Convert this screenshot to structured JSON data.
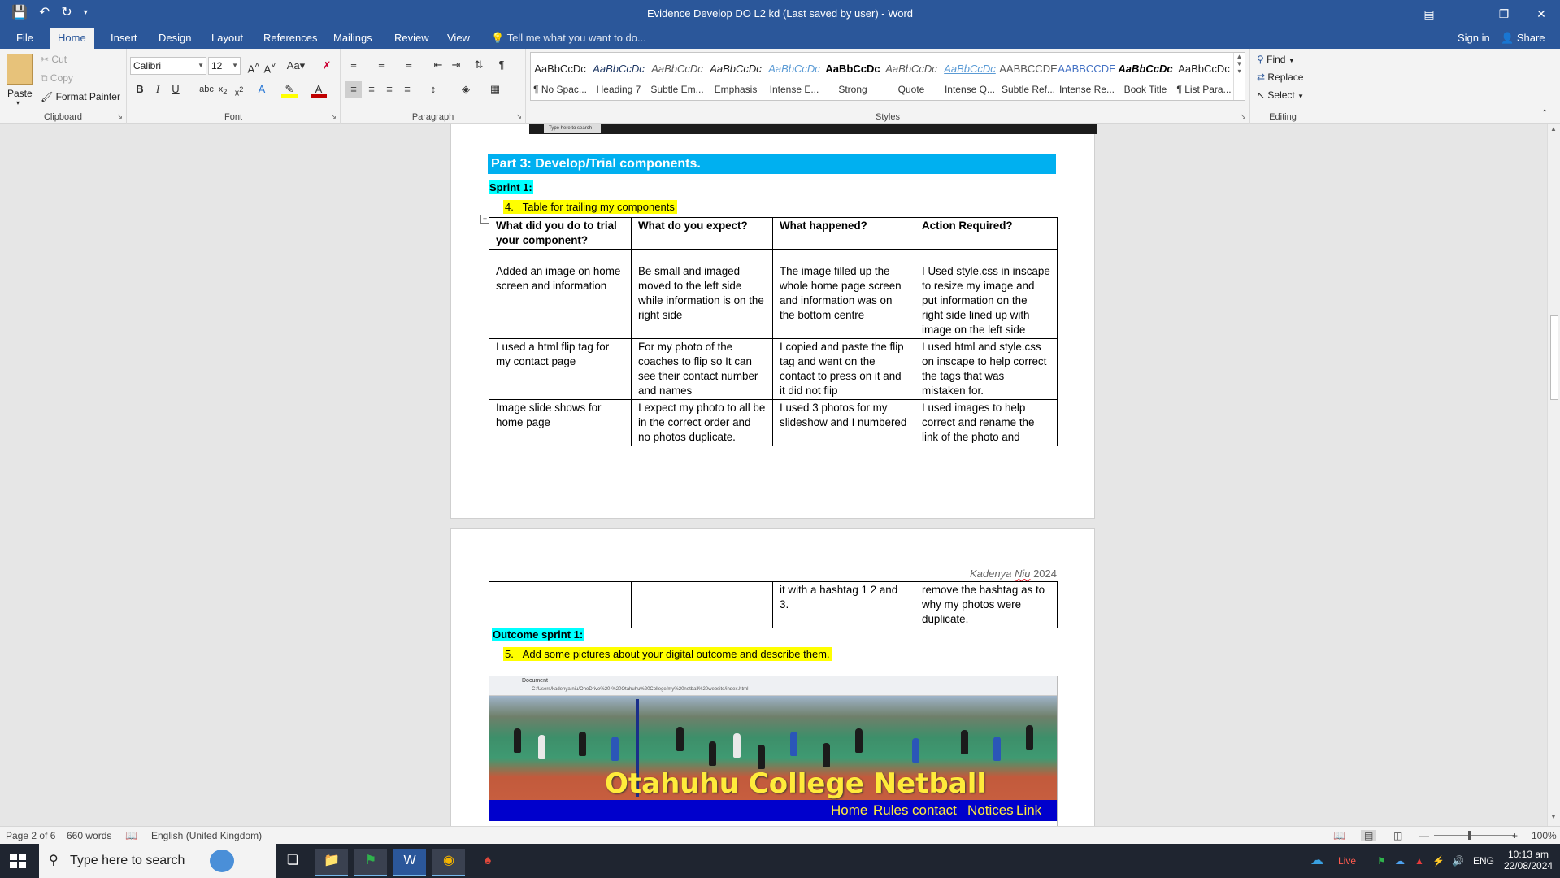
{
  "window": {
    "title": "Evidence Develop DO L2 kd (Last saved by user) - Word",
    "qat": [
      "save-icon",
      "undo-icon",
      "redo-icon",
      "customize-icon"
    ]
  },
  "tabs": [
    "File",
    "Home",
    "Insert",
    "Design",
    "Layout",
    "References",
    "Mailings",
    "Review",
    "View"
  ],
  "active_tab": "Home",
  "tell_me": "Tell me what you want to do...",
  "sign_in": "Sign in",
  "share": "Share",
  "ribbon": {
    "clipboard": {
      "label": "Clipboard",
      "paste": "Paste",
      "cut": "Cut",
      "copy": "Copy",
      "format_painter": "Format Painter"
    },
    "font": {
      "label": "Font",
      "family": "Calibri",
      "size": "12"
    },
    "paragraph": {
      "label": "Paragraph"
    },
    "styles": {
      "label": "Styles",
      "items": [
        {
          "sample": "AaBbCcDc",
          "name": "¶ No Spac...",
          "color": "#222222"
        },
        {
          "sample": "AaBbCcDc",
          "name": "Heading 7",
          "color": "#1f3864"
        },
        {
          "sample": "AaBbCcDc",
          "name": "Subtle Em...",
          "color": "#595959"
        },
        {
          "sample": "AaBbCcDc",
          "name": "Emphasis",
          "color": "#222222"
        },
        {
          "sample": "AaBbCcDc",
          "name": "Intense E...",
          "color": "#5b9bd5"
        },
        {
          "sample": "AaBbCcDc",
          "name": "Strong",
          "color": "#000000"
        },
        {
          "sample": "AaBbCcDc",
          "name": "Quote",
          "color": "#595959"
        },
        {
          "sample": "AaBbCcDc",
          "name": "Intense Q...",
          "color": "#5b9bd5"
        },
        {
          "sample": "AABBCCDE",
          "name": "Subtle Ref...",
          "color": "#595959"
        },
        {
          "sample": "AABBCCDE",
          "name": "Intense Re...",
          "color": "#4472c4"
        },
        {
          "sample": "AaBbCcDc",
          "name": "Book Title",
          "color": "#000000"
        },
        {
          "sample": "AaBbCcDc",
          "name": "¶ List Para...",
          "color": "#222222"
        }
      ]
    },
    "editing": {
      "label": "Editing",
      "find": "Find",
      "replace": "Replace",
      "select": "Select"
    }
  },
  "document": {
    "mini_taskbar_search": "Type here to search",
    "part_heading": "Part 3: Develop/Trial components.",
    "sprint_label": "Sprint 1:",
    "item4": "4.   Table for trailing my components",
    "table": {
      "headers": [
        "What did you do to trial your component?",
        "What do you expect?",
        "What happened?",
        "Action Required?"
      ],
      "rows": [
        [
          "",
          "",
          "",
          ""
        ],
        [
          "Added an image on home screen and information",
          "Be small and imaged moved to the left side while information is on the right side",
          "The image filled up the whole home page screen and information was on the bottom centre",
          "I Used style.css in inscape to resize my image and put information on the right side lined up with image on the left side"
        ],
        [
          "I used a html flip tag for my contact page",
          "For my photo of the coaches to flip so It can see their contact number and names",
          "I copied and paste the flip tag and went on the contact to press on it and it did not flip",
          "I used html and style.css on inscape to help correct the tags that was mistaken for."
        ],
        [
          "Image slide shows for home page",
          "I expect my photo to all be in the correct order and no photos duplicate.",
          "I used 3 photos for my slideshow and I numbered",
          "I used images to help correct and rename the link of the photo and"
        ]
      ],
      "continued_row": [
        "",
        "",
        "it with a hashtag 1 2 and 3.",
        "remove the hashtag as to why my photos were duplicate."
      ]
    },
    "author_name": "Kadenya",
    "author_surname": "Niu",
    "author_year": "2024",
    "outcome_label": "Outcome sprint 1:",
    "item5": "5.   Add some pictures about your digital outcome and describe them.",
    "screenshot": {
      "site_title": "Otahuhu College Netball",
      "nav": [
        "Home",
        "Rules",
        "contact",
        "Notices",
        "Link"
      ],
      "url": "C:/Users/kadenya.niu/OneDrive%20-%20Otahuhu%20College/my%20netball%20website/index.html",
      "tab": "Document"
    }
  },
  "status": {
    "page": "Page 2 of 6",
    "words": "660 words",
    "language": "English (United Kingdom)",
    "zoom": "100%"
  },
  "taskbar": {
    "search": "Type here to search",
    "live": "Live",
    "lang": "ENG",
    "time": "10:13 am",
    "date": "22/08/2024"
  },
  "colors": {
    "word_blue": "#2b579a",
    "heading_bar": "#00b0f0",
    "highlight_cyan": "#00ffff",
    "highlight_yellow": "#ffff00"
  }
}
